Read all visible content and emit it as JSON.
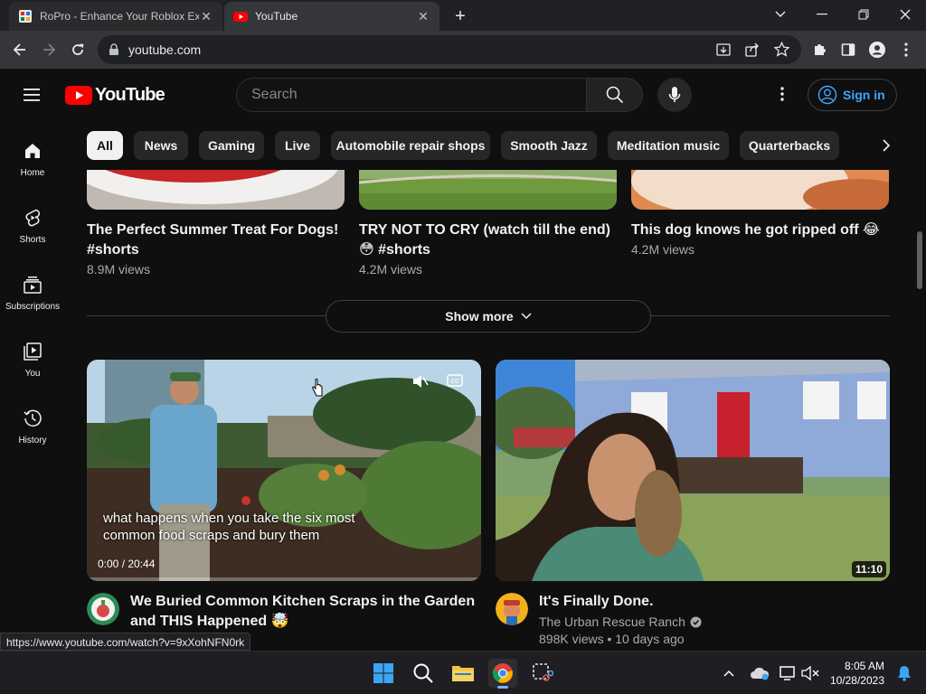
{
  "browser": {
    "tabs": [
      {
        "title": "RoPro - Enhance Your Roblox Experience",
        "active": false
      },
      {
        "title": "YouTube",
        "active": true
      }
    ],
    "url": "youtube.com",
    "status_link": "https://www.youtube.com/watch?v=9xXohNFN0rk"
  },
  "youtube": {
    "logo_text": "YouTube",
    "search_placeholder": "Search",
    "signin_label": "Sign in",
    "sidebar": [
      {
        "label": "Home",
        "icon": "home-icon"
      },
      {
        "label": "Shorts",
        "icon": "shorts-icon"
      },
      {
        "label": "Subscriptions",
        "icon": "subscriptions-icon"
      },
      {
        "label": "You",
        "icon": "you-icon"
      },
      {
        "label": "History",
        "icon": "history-icon"
      }
    ],
    "chips": [
      "All",
      "News",
      "Gaming",
      "Live",
      "Automobile repair shops",
      "Smooth Jazz",
      "Meditation music",
      "Quarterbacks"
    ],
    "shorts": [
      {
        "title_line1": "The Perfect Summer Treat For Dogs!",
        "title_line2": "#shorts",
        "views": "8.9M views"
      },
      {
        "title_line1": "TRY NOT TO CRY (watch till the end)",
        "title_line2": "😳 #shorts",
        "views": "4.2M views"
      },
      {
        "title_line1": "This dog knows he got ripped off 😂",
        "title_line2": "",
        "views": "4.2M views"
      }
    ],
    "show_more_label": "Show more",
    "videos": [
      {
        "title_line1": "We Buried Common Kitchen Scraps in the Garden",
        "title_line2": "and THIS Happened 🤯",
        "caption_line1": "what happens when you take the six most",
        "caption_line2": "common food scraps and bury them",
        "progress_text": "0:00 / 20:44",
        "channel": "",
        "meta": ""
      },
      {
        "title_line1": "It's Finally Done.",
        "title_line2": "",
        "duration": "11:10",
        "channel": "The Urban Rescue Ranch",
        "meta": "898K views • 10 days ago"
      }
    ]
  },
  "taskbar": {
    "time": "8:05 AM",
    "date": "10/28/2023"
  },
  "colors": {
    "yt_red": "#ff0000",
    "link_blue": "#3ea6ff",
    "background": "#0f0f0f"
  }
}
